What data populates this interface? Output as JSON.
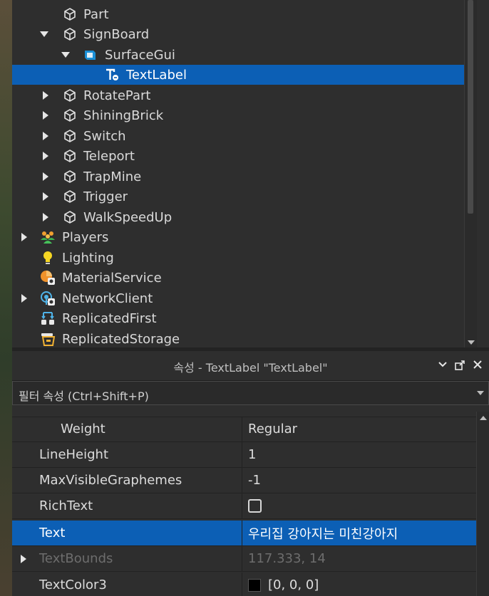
{
  "explorer": {
    "items": [
      {
        "label": "Part",
        "icon": "part-cube-icon"
      },
      {
        "label": "SignBoard",
        "icon": "part-cube-icon"
      },
      {
        "label": "SurfaceGui",
        "icon": "surfacegui-icon"
      },
      {
        "label": "TextLabel",
        "icon": "textlabel-icon"
      },
      {
        "label": "RotatePart",
        "icon": "part-cube-icon"
      },
      {
        "label": "ShiningBrick",
        "icon": "part-cube-icon"
      },
      {
        "label": "Switch",
        "icon": "part-cube-icon"
      },
      {
        "label": "Teleport",
        "icon": "part-cube-icon"
      },
      {
        "label": "TrapMine",
        "icon": "part-cube-icon"
      },
      {
        "label": "Trigger",
        "icon": "part-cube-icon"
      },
      {
        "label": "WalkSpeedUp",
        "icon": "part-cube-icon"
      },
      {
        "label": "Players",
        "icon": "players-icon"
      },
      {
        "label": "Lighting",
        "icon": "lighting-bulb-icon"
      },
      {
        "label": "MaterialService",
        "icon": "material-service-icon"
      },
      {
        "label": "NetworkClient",
        "icon": "network-client-icon"
      },
      {
        "label": "ReplicatedFirst",
        "icon": "replicated-first-icon"
      },
      {
        "label": "ReplicatedStorage",
        "icon": "replicated-storage-icon"
      }
    ]
  },
  "properties": {
    "title": "속성 - TextLabel \"TextLabel\"",
    "filter_placeholder": "필터 속성 (Ctrl+Shift+P)",
    "rows": [
      {
        "name": "Weight",
        "value": "Regular"
      },
      {
        "name": "LineHeight",
        "value": "1"
      },
      {
        "name": "MaxVisibleGraphemes",
        "value": "-1"
      },
      {
        "name": "RichText",
        "value": ""
      },
      {
        "name": "Text",
        "value": "우리집 강아지는 미친강아지"
      },
      {
        "name": "TextBounds",
        "value": "117.333, 14"
      },
      {
        "name": "TextColor3",
        "value": "[0, 0, 0]"
      }
    ]
  },
  "colors": {
    "selection": "#0c5fb5",
    "panel_bg": "#2e2e2e",
    "text": "#d9d9d9"
  }
}
